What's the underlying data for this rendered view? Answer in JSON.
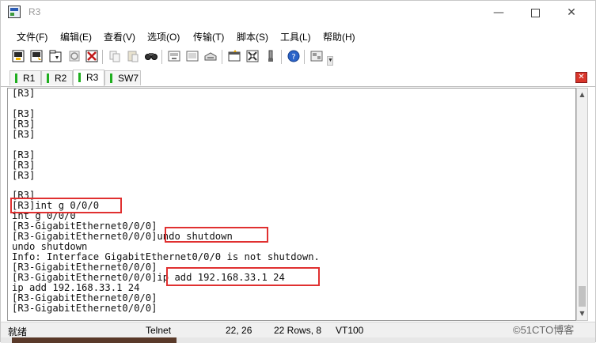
{
  "window": {
    "title": "R3"
  },
  "menu": {
    "items": [
      "文件(F)",
      "编辑(E)",
      "查看(V)",
      "选项(O)",
      "传输(T)",
      "脚本(S)",
      "工具(L)",
      "帮助(H)"
    ]
  },
  "toolbar": {
    "icons": [
      "connect-icon",
      "quick-connect-icon",
      "connect-tab-icon",
      "reconnect-icon",
      "disconnect-icon",
      "copy-icon",
      "paste-icon",
      "find-icon",
      "print-icon",
      "print-setup-icon",
      "session-options-icon",
      "global-options-icon",
      "keymap-icon",
      "help-icon",
      "sftp-icon"
    ]
  },
  "tabs": [
    {
      "label": "R1",
      "active": false
    },
    {
      "label": "R2",
      "active": false
    },
    {
      "label": "R3",
      "active": true
    },
    {
      "label": "SW7",
      "active": false
    }
  ],
  "terminal": {
    "lines": [
      "[R3]",
      "",
      "[R3]",
      "[R3]",
      "[R3]",
      "",
      "[R3]",
      "[R3]",
      "[R3]",
      "",
      "[R3]",
      "[R3]int g 0/0/0",
      "int g 0/0/0",
      "[R3-GigabitEthernet0/0/0]",
      "[R3-GigabitEthernet0/0/0]undo shutdown",
      "undo shutdown",
      "Info: Interface GigabitEthernet0/0/0 is not shutdown.",
      "[R3-GigabitEthernet0/0/0]",
      "[R3-GigabitEthernet0/0/0]ip add 192.168.33.1 24",
      "ip add 192.168.33.1 24",
      "[R3-GigabitEthernet0/0/0]",
      "[R3-GigabitEthernet0/0/0]"
    ],
    "highlight_color": "#e03030"
  },
  "status": {
    "state": "就绪",
    "protocol": "Telnet",
    "cursor": "22,  26",
    "size": "22 Rows,  8",
    "emulation": "VT100"
  },
  "watermark": "©51CTO博客"
}
